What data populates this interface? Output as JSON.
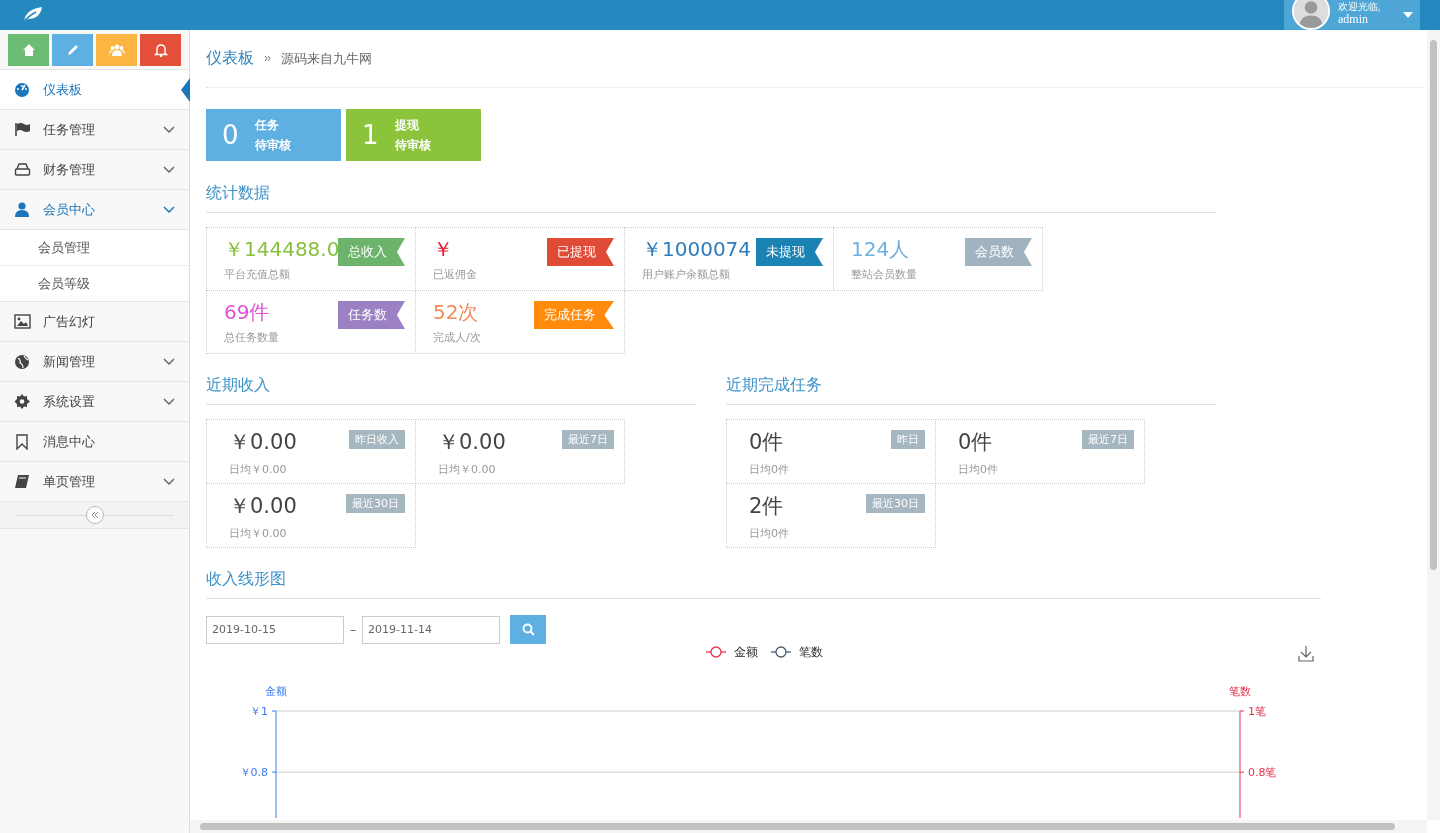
{
  "header": {
    "greeting": "欢迎光临,",
    "user": "admin"
  },
  "shortcuts": [
    {
      "color": "#6cbd73"
    },
    {
      "color": "#5eb0e2"
    },
    {
      "color": "#fbb540"
    },
    {
      "color": "#e4503a"
    }
  ],
  "sidebar": {
    "items": [
      {
        "label": "仪表板",
        "selected": true
      },
      {
        "label": "任务管理",
        "selected": false,
        "expanded": false
      },
      {
        "label": "财务管理",
        "selected": false,
        "expanded": false
      },
      {
        "label": "会员中心",
        "selected": false,
        "expanded": true,
        "children": [
          {
            "label": "会员管理"
          },
          {
            "label": "会员等级"
          }
        ]
      },
      {
        "label": "广告幻灯",
        "selected": false
      },
      {
        "label": "新闻管理",
        "selected": false,
        "expanded": false
      },
      {
        "label": "系统设置",
        "selected": false,
        "expanded": false
      },
      {
        "label": "消息中心",
        "selected": false
      },
      {
        "label": "单页管理",
        "selected": false,
        "expanded": false
      }
    ]
  },
  "breadcrumb": {
    "title": "仪表板",
    "path": "源码来自九牛网"
  },
  "pending": [
    {
      "count": "0",
      "label": "任务",
      "sub": "待审核",
      "color": "#5eb0e2"
    },
    {
      "count": "1",
      "label": "提现",
      "sub": "待审核",
      "color": "#8bc43a"
    }
  ],
  "stats": {
    "title": "统计数据",
    "cells": [
      {
        "value": "￥144488.0",
        "label": "平台充值总额",
        "tag": "总收入",
        "color": "#6cb46b"
      },
      {
        "value": "￥",
        "label": "已返佣金",
        "tag": "已提现",
        "color": "#e04b37"
      },
      {
        "value": "￥1000074",
        "label": "用户账户余额总额",
        "tag": "未提现",
        "color": "#1b83b4"
      },
      {
        "value": "124人",
        "label": "整站会员数量",
        "tag": "会员数",
        "color": "#a2b3c0"
      },
      {
        "value": "69件",
        "label": "总任务数量",
        "tag": "任务数",
        "color": "#9b80c4"
      },
      {
        "value": "52次",
        "label": "完成人/次",
        "tag": "完成任务",
        "color": "#ff8a0c"
      }
    ]
  },
  "recent_income": {
    "title": "近期收入",
    "cells": [
      {
        "value": "￥0.00",
        "tag": "昨日收入",
        "average": "日均￥0.00"
      },
      {
        "value": "￥0.00",
        "tag": "最近7日",
        "average": "日均￥0.00"
      },
      {
        "value": "￥0.00",
        "tag": "最近30日",
        "average": "日均￥0.00"
      }
    ]
  },
  "recent_tasks": {
    "title": "近期完成任务",
    "cells": [
      {
        "value": "0件",
        "tag": "昨日",
        "average": "日均0件"
      },
      {
        "value": "0件",
        "tag": "最近7日",
        "average": "日均0件"
      },
      {
        "value": "2件",
        "tag": "最近30日",
        "average": "日均0件"
      }
    ]
  },
  "income_chart": {
    "title": "收入线形图",
    "date_from": "2019-10-15",
    "separator": "–",
    "date_to": "2019-11-14",
    "chart_data": {
      "type": "line",
      "ylabel": "金额",
      "y2label": "笔数",
      "ylim": [
        0.65,
        1
      ],
      "y2lim": [
        0.65,
        1
      ],
      "yticks": [
        {
          "value": 1,
          "label": "￥1"
        },
        {
          "value": 0.8,
          "label": "￥0.8"
        }
      ],
      "y2ticks": [
        {
          "value": 1,
          "label": "1笔"
        },
        {
          "value": 0.8,
          "label": "0.8笔"
        }
      ],
      "series": [
        {
          "name": "金额",
          "color": "#e5324f"
        },
        {
          "name": "笔数",
          "color": "#4b5a6e"
        }
      ]
    }
  }
}
